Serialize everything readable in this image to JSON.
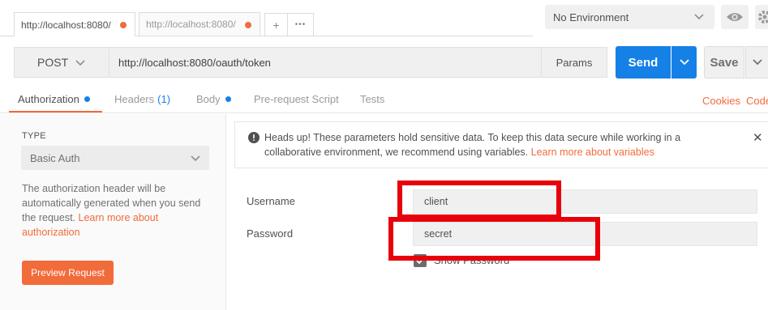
{
  "tabs": [
    {
      "label": "http://localhost:8080/",
      "active": true
    },
    {
      "label": "http://localhost:8080/",
      "active": false
    }
  ],
  "tab_actions": {
    "add": "+",
    "more": "•••"
  },
  "environment": {
    "selected": "No Environment"
  },
  "request": {
    "method": "POST",
    "url": "http://localhost:8080/oauth/token",
    "params_label": "Params",
    "send_label": "Send",
    "save_label": "Save"
  },
  "subtabs": {
    "authorization": "Authorization",
    "headers": "Headers",
    "headers_count": "(1)",
    "body": "Body",
    "prerequest": "Pre-request Script",
    "tests": "Tests",
    "cookies": "Cookies",
    "code": "Code"
  },
  "auth": {
    "type_label": "TYPE",
    "type_value": "Basic Auth",
    "desc": "The authorization header will be automatically generated when you send the request. ",
    "desc_link": "Learn more about authorization",
    "preview_button": "Preview Request"
  },
  "notice": {
    "text": "Heads up! These parameters hold sensitive data. To keep this data secure while working in a collaborative environment, we recommend using variables. ",
    "link": "Learn more about variables"
  },
  "fields": {
    "username_label": "Username",
    "username_value": "client",
    "password_label": "Password",
    "password_value": "secret",
    "show_password_label": "Show Password",
    "show_password_checked": true
  },
  "colors": {
    "accent": "#f26b3a",
    "primary": "#1581e6",
    "highlight": "#e8000b"
  }
}
